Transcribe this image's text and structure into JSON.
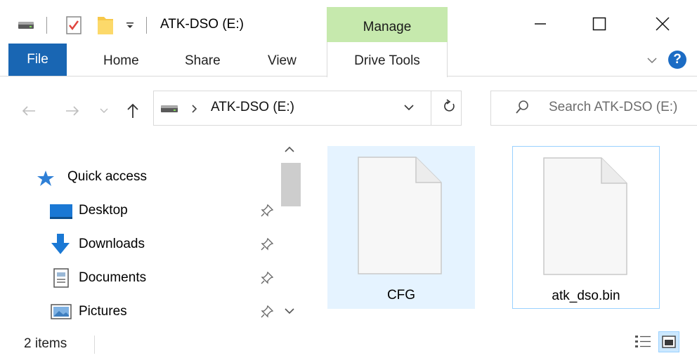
{
  "window": {
    "title": "ATK-DSO (E:)",
    "contextual_group": "Manage"
  },
  "ribbon": {
    "tabs": [
      "File",
      "Home",
      "Share",
      "View",
      "Drive Tools"
    ]
  },
  "address": {
    "path": "ATK-DSO (E:)",
    "search_placeholder": "Search ATK-DSO (E:)"
  },
  "nav": {
    "quick_access": "Quick access",
    "items": [
      {
        "label": "Desktop",
        "icon": "desktop-icon"
      },
      {
        "label": "Downloads",
        "icon": "downloads-icon"
      },
      {
        "label": "Documents",
        "icon": "documents-icon"
      },
      {
        "label": "Pictures",
        "icon": "pictures-icon"
      }
    ]
  },
  "files": [
    {
      "name": "CFG",
      "state": "hover"
    },
    {
      "name": "atk_dso.bin",
      "state": "focused"
    }
  ],
  "status": {
    "count": "2 items"
  },
  "colors": {
    "accent": "#1966b3",
    "manage_tab": "#c6e9ad",
    "selection_fill": "#e5f3ff",
    "focus_border": "#99d1ff",
    "help": "#1c6cc4"
  }
}
